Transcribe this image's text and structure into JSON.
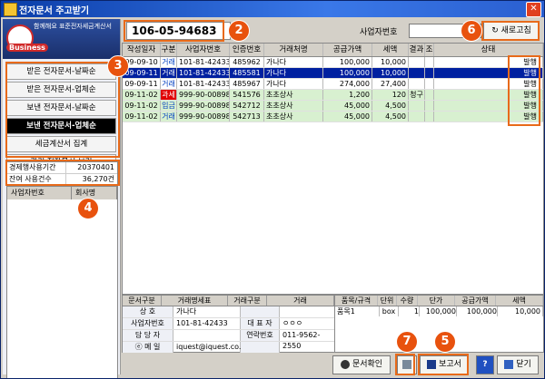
{
  "window": {
    "title": "전자문서 주고받기",
    "close_label": "✕"
  },
  "logo": {
    "text": "함께해요 표준전자세금계산서",
    "brand": "Business"
  },
  "menu": [
    "받은 전자문서-날짜순",
    "받은 전자문서-업체순",
    "보낸 전자문서-날짜순",
    "보낸 전자문서-업체순",
    "세금계산서 집계",
    "과거 전자문서 보기"
  ],
  "info": [
    {
      "key": "경제행사용기간",
      "value": "20370401"
    },
    {
      "key": "잔여 사용건수",
      "value": "36,270건"
    }
  ],
  "left_grid": {
    "col1": "사업자번호",
    "col2": "회사명"
  },
  "top": {
    "business_number": "106-05-94683",
    "search_label": "사업자번호",
    "search_value": "",
    "refresh_label": "새로고침"
  },
  "table": {
    "headers": [
      "작성일자",
      "구분",
      "사업자번호",
      "인증번호",
      "거래처명",
      "공급가액",
      "세액",
      "결과",
      "조",
      "상태"
    ],
    "rows": [
      {
        "date": "09-09-10",
        "kind": "거래",
        "biz": "101-81-42433",
        "cert": "485962",
        "name": "가나다",
        "supply": "100,000",
        "tax": "10,000",
        "result": "",
        "chk": "",
        "status": "발행"
      },
      {
        "date": "09-09-11",
        "kind": "거래",
        "biz": "101-81-42433",
        "cert": "485581",
        "name": "가나다",
        "supply": "100,000",
        "tax": "10,000",
        "result": "",
        "chk": "",
        "status": "발행"
      },
      {
        "date": "09-09-11",
        "kind": "거래",
        "biz": "101-81-42433",
        "cert": "485967",
        "name": "가나다",
        "supply": "274,000",
        "tax": "27,400",
        "result": "",
        "chk": "",
        "status": "발행"
      },
      {
        "date": "09-11-02",
        "kind": "과세",
        "biz": "999-90-00898",
        "cert": "541576",
        "name": "초초상사",
        "supply": "1,200",
        "tax": "120",
        "result": "청구",
        "chk": "",
        "status": "발행"
      },
      {
        "date": "09-11-02",
        "kind": "입금",
        "biz": "999-90-00898",
        "cert": "542712",
        "name": "초초상사",
        "supply": "45,000",
        "tax": "4,500",
        "result": "",
        "chk": "",
        "status": "발행"
      },
      {
        "date": "09-11-02",
        "kind": "거래",
        "biz": "999-90-00898",
        "cert": "542713",
        "name": "초초상사",
        "supply": "45,000",
        "tax": "4,500",
        "result": "",
        "chk": "",
        "status": "발행"
      }
    ]
  },
  "detail": {
    "h1": "문서구분",
    "h1v": "거래명세표",
    "h2": "거래구분",
    "h2v": "거래",
    "rows": [
      {
        "k": "상 호",
        "v": "가나다",
        "k2": "",
        "v2": ""
      },
      {
        "k": "사업자번호",
        "v": "101-81-42433",
        "k2": "대 표 자",
        "v2": "ㅇㅇㅇ"
      },
      {
        "k": "담 당 자",
        "v": "",
        "k2": "연락번호",
        "v2": "011-9562-2550"
      },
      {
        "k": "ⓔ 메 일",
        "v": "iquest@iquest.co.kr",
        "k2": "",
        "v2": ""
      }
    ]
  },
  "items": {
    "headers": [
      "품목/규격",
      "단위",
      "수량",
      "단가",
      "공급가액",
      "세액"
    ],
    "rows": [
      {
        "item": "품목1",
        "unit": "box",
        "qty": "1",
        "price": "100,000",
        "supply": "100,000",
        "tax": "10,000"
      }
    ]
  },
  "buttons": {
    "confirm": "문서확인",
    "report": "보고서",
    "help": "?",
    "close": "닫기"
  },
  "badges": [
    "2",
    "3",
    "4",
    "5",
    "6",
    "7"
  ],
  "colors": {
    "highlight": "#e86a1a",
    "selected": "#0020a0",
    "green_row": "#d8f0d0"
  }
}
